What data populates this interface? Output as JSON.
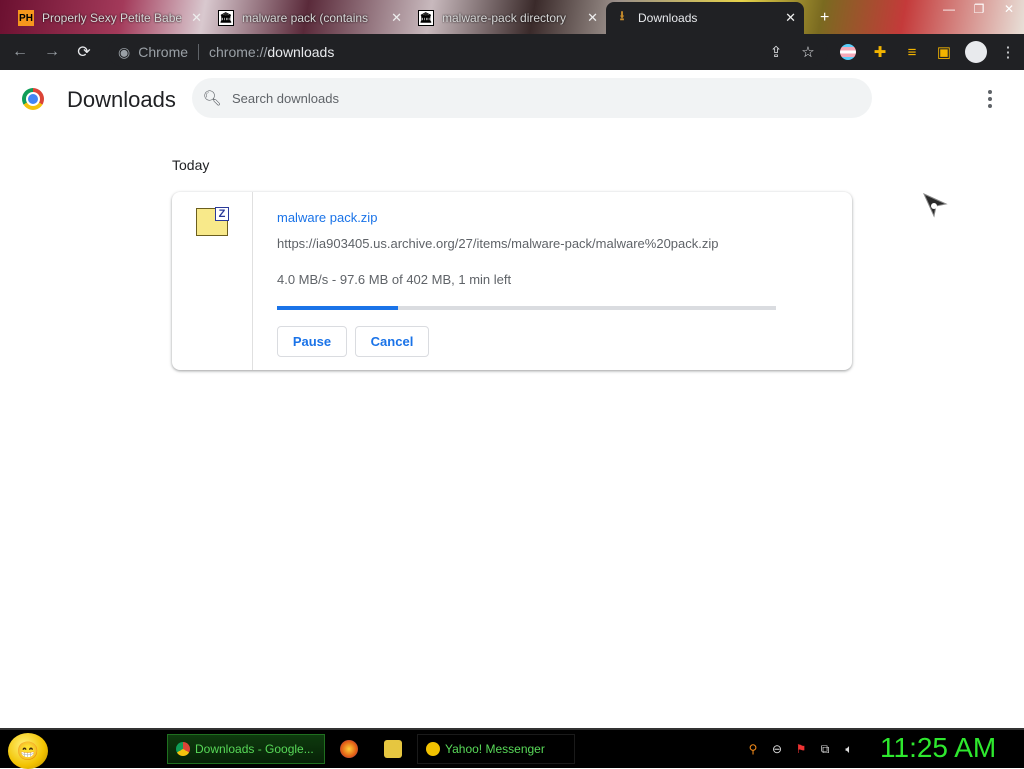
{
  "window": {
    "tabs": [
      {
        "label": "Properly Sexy Petite Babe",
        "favicon": "PH"
      },
      {
        "label": "malware pack (contains",
        "favicon": "archive-icon"
      },
      {
        "label": "malware-pack directory",
        "favicon": "archive-icon"
      },
      {
        "label": "Downloads",
        "favicon": "download-icon",
        "active": true
      }
    ],
    "new_tab": "+"
  },
  "toolbar": {
    "site_label": "Chrome",
    "url_scheme": "chrome://",
    "url_path": "downloads"
  },
  "page": {
    "title": "Downloads",
    "search_placeholder": "Search downloads"
  },
  "downloads": {
    "group_label": "Today",
    "items": [
      {
        "filename": "malware pack.zip",
        "url": "https://ia903405.us.archive.org/27/items/malware-pack/malware%20pack.zip",
        "status": "4.0 MB/s - 97.6 MB of 402 MB, 1 min left",
        "progress_fraction": 0.243,
        "pause_label": "Pause",
        "cancel_label": "Cancel"
      }
    ]
  },
  "taskbar": {
    "tasks": [
      {
        "label": "Downloads - Google...",
        "active": true
      },
      {
        "label": "Yahoo! Messenger",
        "active": false
      }
    ],
    "clock": "11:25 AM"
  },
  "colors": {
    "accent": "#1a73e8",
    "clock": "#2ee82e"
  }
}
